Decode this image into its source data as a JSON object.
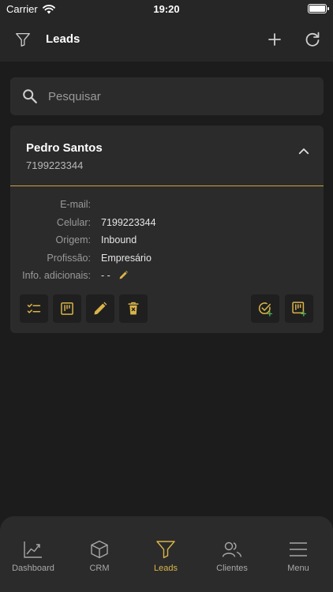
{
  "status_bar": {
    "carrier": "Carrier",
    "time": "19:20"
  },
  "nav": {
    "title": "Leads"
  },
  "search": {
    "placeholder": "Pesquisar"
  },
  "lead": {
    "name": "Pedro Santos",
    "phone": "7199223344",
    "fields": [
      {
        "label": "E-mail:",
        "value": ""
      },
      {
        "label": "Celular:",
        "value": "7199223344"
      },
      {
        "label": "Origem:",
        "value": "Inbound"
      },
      {
        "label": "Profissão:",
        "value": "Empresário"
      },
      {
        "label": "Info. adicionais:",
        "value": "- -"
      }
    ]
  },
  "tabs": [
    {
      "label": "Dashboard",
      "icon": "chart-line-icon"
    },
    {
      "label": "CRM",
      "icon": "cube-icon"
    },
    {
      "label": "Leads",
      "icon": "filter-icon"
    },
    {
      "label": "Clientes",
      "icon": "users-icon"
    },
    {
      "label": "Menu",
      "icon": "menu-icon"
    }
  ],
  "colors": {
    "accent": "#d9b44a",
    "background": "#1c1c1c",
    "card": "#2b2b2b",
    "bar": "#262626",
    "success": "#4caf50"
  }
}
